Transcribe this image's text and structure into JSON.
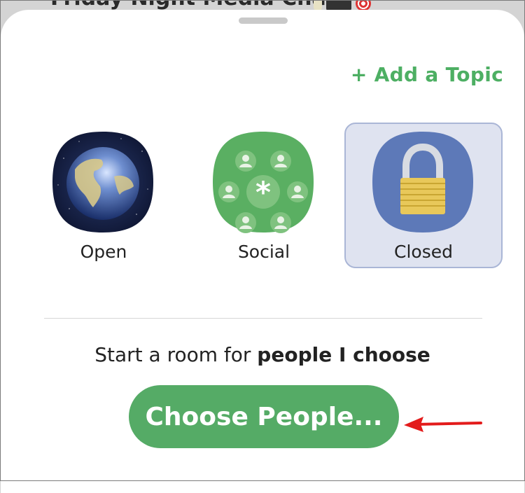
{
  "background": {
    "title": "Friday Night Media Chat",
    "icons": [
      "lightbulb-icon",
      "game-controller-icon",
      "target-icon"
    ]
  },
  "header": {
    "add_topic_label": "+ Add a Topic"
  },
  "room_types": [
    {
      "label": "Open",
      "icon": "globe-icon",
      "selected": false
    },
    {
      "label": "Social",
      "icon": "people-circle-icon",
      "selected": false
    },
    {
      "label": "Closed",
      "icon": "padlock-icon",
      "selected": true
    }
  ],
  "description": {
    "prefix": "Start a room for ",
    "emphasis": "people I choose"
  },
  "primary_button": {
    "label": "Choose People..."
  },
  "colors": {
    "accent_green": "#55ab66",
    "selected_bg": "#dfe3f0",
    "annotation_arrow": "#e31b1b"
  }
}
